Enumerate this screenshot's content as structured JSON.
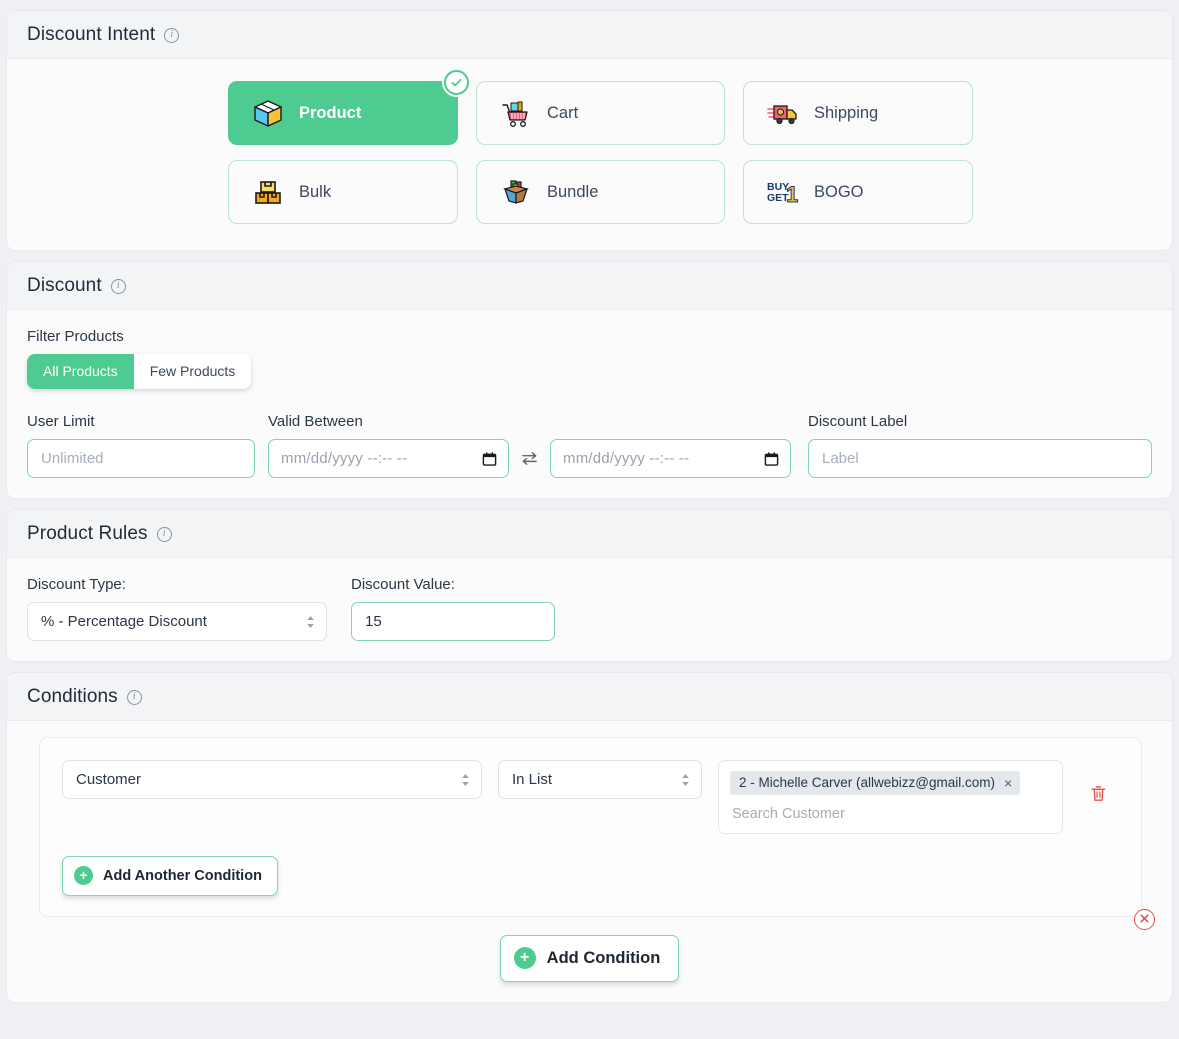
{
  "sections": {
    "intent": {
      "title": "Discount Intent",
      "info_icon": "info-icon",
      "cards": [
        {
          "label": "Product",
          "icon": "package-icon",
          "selected": true
        },
        {
          "label": "Cart",
          "icon": "shopping-cart-icon",
          "selected": false
        },
        {
          "label": "Shipping",
          "icon": "delivery-truck-icon",
          "selected": false
        },
        {
          "label": "Bulk",
          "icon": "stacked-boxes-icon",
          "selected": false
        },
        {
          "label": "Bundle",
          "icon": "open-box-icon",
          "selected": false
        },
        {
          "label": "BOGO",
          "icon": "buy-one-get-one-icon",
          "selected": false
        }
      ],
      "bogo_icon_text": {
        "line1": "BUY",
        "line2": "GET",
        "numeral": "1"
      }
    },
    "discount": {
      "title": "Discount",
      "filter_products_label": "Filter Products",
      "filter_options": [
        {
          "label": "All Products",
          "active": true
        },
        {
          "label": "Few Products",
          "active": false
        }
      ],
      "user_limit": {
        "label": "User Limit",
        "value": "",
        "placeholder": "Unlimited"
      },
      "valid_between": {
        "label": "Valid Between",
        "start": {
          "value": "",
          "placeholder": "mm/dd/yyyy --:-- --"
        },
        "end": {
          "value": "",
          "placeholder": "mm/dd/yyyy --:-- --"
        },
        "swap_icon": "swap-arrows-icon"
      },
      "discount_label_field": {
        "label": "Discount Label",
        "value": "",
        "placeholder": "Label"
      }
    },
    "product_rules": {
      "title": "Product Rules",
      "discount_type": {
        "label": "Discount Type:",
        "value": "% - Percentage Discount"
      },
      "discount_value": {
        "label": "Discount Value:",
        "value": "15"
      }
    },
    "conditions": {
      "title": "Conditions",
      "rows": [
        {
          "attribute": "Customer",
          "operator": "In List",
          "tokens": [
            {
              "text": "2 - Michelle Carver (allwebizz@gmail.com)",
              "remove": "×"
            }
          ],
          "search_placeholder": "Search Customer",
          "delete_icon": "trash-icon"
        }
      ],
      "add_another_label": "Add Another Condition",
      "add_condition_label": "Add Condition",
      "remove_group_icon": "close-circle-icon",
      "plus_glyph": "+"
    }
  },
  "colors": {
    "accent_green": "#4ecb91",
    "border_green": "#7fd7ab",
    "danger_red": "#ef4b4b",
    "page_bg": "#eef0f3",
    "panel_bg": "#fbfbfb",
    "header_bg": "#f2f4f6",
    "text_dark": "#2b3747"
  }
}
